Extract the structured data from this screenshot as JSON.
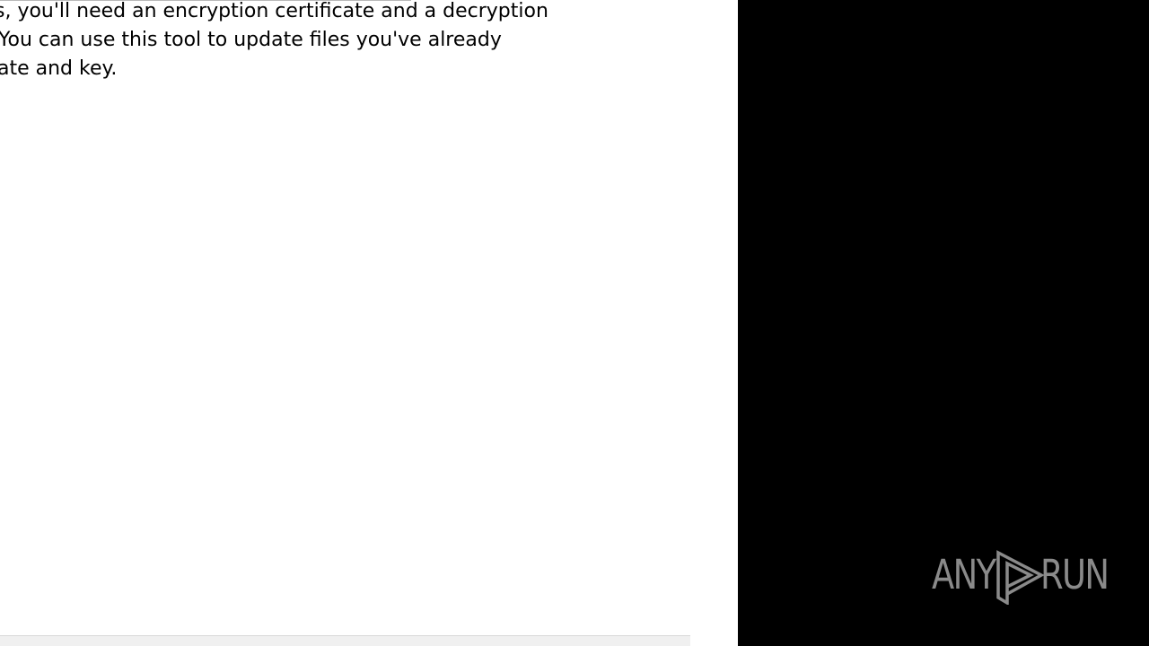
{
  "dialog": {
    "description_lines": [
      "s, you'll need an encryption certificate and a decryption",
      "You can use this tool to update files you've already",
      "ate and key."
    ]
  },
  "watermark": {
    "brand_left": "ANY",
    "brand_right": "RUN",
    "icon": "play-triangle-icon",
    "color": "#8a8a8a"
  },
  "colors": {
    "dialog_background": "#ffffff",
    "side_panel": "#000000"
  }
}
